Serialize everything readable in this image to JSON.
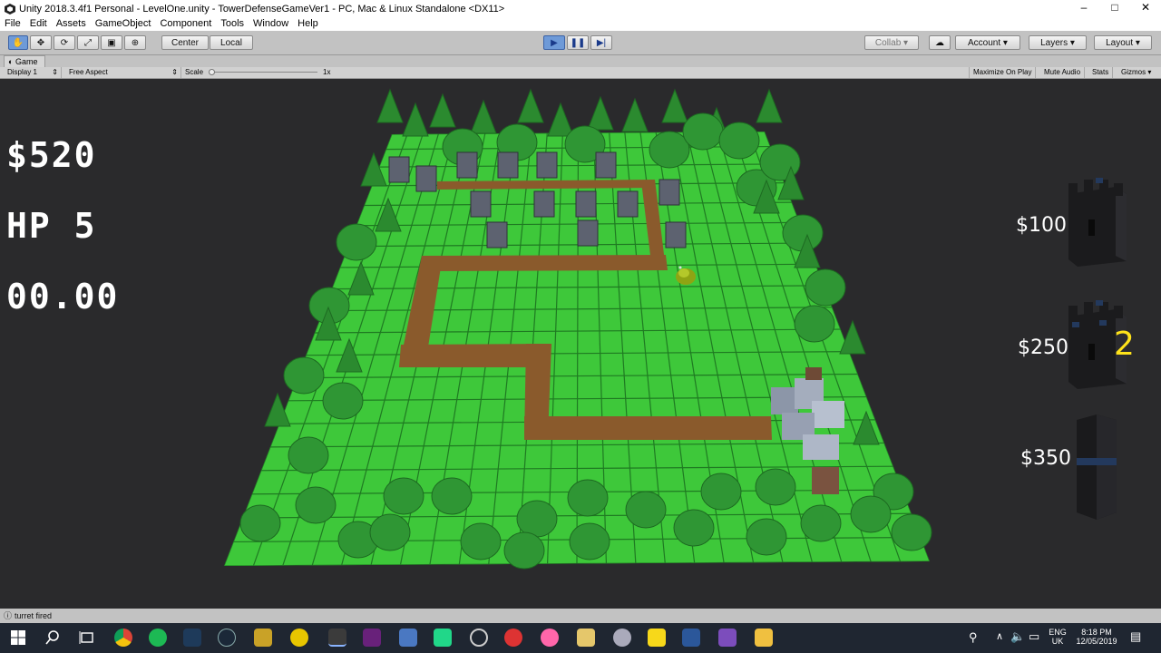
{
  "window": {
    "title": "Unity 2018.3.4f1 Personal - LevelOne.unity - TowerDefenseGameVer1 - PC, Mac & Linux Standalone <DX11>",
    "minimize": "–",
    "maximize": "□",
    "close": "✕"
  },
  "menu": [
    "File",
    "Edit",
    "Assets",
    "GameObject",
    "Component",
    "Tools",
    "Window",
    "Help"
  ],
  "toolbar": {
    "pivot": "Center",
    "space": "Local",
    "collab": "Collab ▾",
    "account": "Account",
    "layers": "Layers",
    "layout": "Layout",
    "play_state": "playing"
  },
  "game_tab": {
    "label": "Game",
    "display": "Display 1",
    "aspect": "Free Aspect",
    "scale_label": "Scale",
    "scale_value": "1x",
    "maximize_on_play": "Maximize On Play",
    "mute_audio": "Mute Audio",
    "stats": "Stats",
    "gizmos": "Gizmos"
  },
  "hud": {
    "money": "$520",
    "hp": "HP 5",
    "timer": "00.00"
  },
  "shop": [
    {
      "price": "$100",
      "count": ""
    },
    {
      "price": "$250",
      "count": "2"
    },
    {
      "price": "$350",
      "count": ""
    }
  ],
  "console": {
    "message": "turret fired"
  },
  "tray": {
    "lang": "ENG",
    "region": "UK",
    "time": "8:18 PM",
    "date": "12/05/2019"
  },
  "colors": {
    "grass": "#3ec83a",
    "path": "#8a5a2c",
    "tree": "#2b8a2f",
    "background": "#2a2a2c",
    "accent_yellow": "#ffe31a"
  }
}
